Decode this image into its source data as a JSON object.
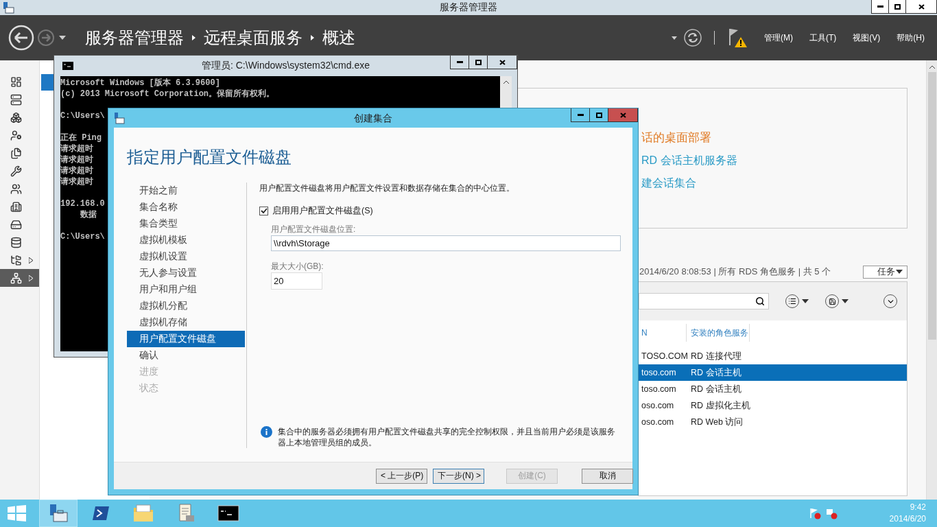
{
  "main_window": {
    "title": "服务器管理器",
    "breadcrumb": [
      "服务器管理器",
      "远程桌面服务",
      "概述"
    ],
    "menus": [
      "管理(M)",
      "工具(T)",
      "视图(V)",
      "帮助(H)"
    ],
    "sidebar": [
      {
        "selected": false,
        "expandable": false
      },
      {
        "selected": false,
        "expandable": false
      },
      {
        "selected": false,
        "expandable": false
      },
      {
        "selected": false,
        "expandable": false
      },
      {
        "selected": false,
        "expandable": false
      },
      {
        "selected": false,
        "expandable": false
      },
      {
        "selected": false,
        "expandable": false
      },
      {
        "selected": false,
        "expandable": false
      },
      {
        "selected": false,
        "expandable": false
      },
      {
        "selected": false,
        "expandable": false
      },
      {
        "selected": false,
        "expandable": true
      },
      {
        "selected": true,
        "expandable": true
      }
    ],
    "overview_links": [
      {
        "text": "话的桌面部署",
        "kind": "primary"
      },
      {
        "text": "RD 会话主机服务器",
        "kind": "secondary"
      },
      {
        "text": "建会话集合",
        "kind": "secondary"
      }
    ],
    "servers": {
      "summary": "2014/6/20 8:08:53 | 所有 RDS 角色服务 | 共 5 个",
      "tasks_button": "任务",
      "columns": [
        "N",
        "安装的角色服务"
      ],
      "rows": [
        {
          "cells": [
            "TOSO.COM",
            "RD 连接代理"
          ],
          "selected": false
        },
        {
          "cells": [
            "toso.com",
            "RD 会话主机"
          ],
          "selected": true
        },
        {
          "cells": [
            "toso.com",
            "RD 会话主机"
          ],
          "selected": false
        },
        {
          "cells": [
            "oso.com",
            "RD 虚拟化主机"
          ],
          "selected": false
        },
        {
          "cells": [
            "oso.com",
            "RD Web 访问"
          ],
          "selected": false
        }
      ]
    }
  },
  "cmd_window": {
    "title": "管理员: C:\\Windows\\system32\\cmd.exe",
    "output": [
      [
        "Microsoft Windows [版本 6.3.9600]",
        "(c) 2013 Microsoft Corporation。保留所有权利。"
      ],
      [
        "C:\\Users\\"
      ],
      [
        "正在 Ping",
        "请求超时",
        "请求超时",
        "请求超时",
        "请求超时"
      ],
      [
        "192.168.0",
        "    数据"
      ],
      [
        "C:\\Users\\"
      ]
    ]
  },
  "dialog": {
    "title": "创建集合",
    "heading": "指定用户配置文件磁盘",
    "steps": [
      {
        "label": "开始之前",
        "selected": false,
        "disabled": false
      },
      {
        "label": "集合名称",
        "selected": false,
        "disabled": false
      },
      {
        "label": "集合类型",
        "selected": false,
        "disabled": false
      },
      {
        "label": "虚拟机模板",
        "selected": false,
        "disabled": false
      },
      {
        "label": "虚拟机设置",
        "selected": false,
        "disabled": false
      },
      {
        "label": "无人参与设置",
        "selected": false,
        "disabled": false
      },
      {
        "label": "用户和用户组",
        "selected": false,
        "disabled": false
      },
      {
        "label": "虚拟机分配",
        "selected": false,
        "disabled": false
      },
      {
        "label": "虚拟机存储",
        "selected": false,
        "disabled": false
      },
      {
        "label": "用户配置文件磁盘",
        "selected": true,
        "disabled": false
      },
      {
        "label": "确认",
        "selected": false,
        "disabled": false
      },
      {
        "label": "进度",
        "selected": false,
        "disabled": true
      },
      {
        "label": "状态",
        "selected": false,
        "disabled": true
      }
    ],
    "description": "用户配置文件磁盘将用户配置文件设置和数据存储在集合的中心位置。",
    "enable_checkbox": {
      "label": "启用用户配置文件磁盘(S)",
      "checked": true
    },
    "location": {
      "label": "用户配置文件磁盘位置:",
      "value": "\\\\rdvh\\Storage"
    },
    "max_size": {
      "label": "最大大小(GB):",
      "value": "20"
    },
    "note": "集合中的服务器必须拥有用户配置文件磁盘共享的完全控制权限，并且当前用户必须是该服务器上本地管理员组的成员。",
    "buttons": [
      {
        "label": "< 上一步(P)",
        "disabled": false,
        "focused": false
      },
      {
        "label": "下一步(N) >",
        "disabled": false,
        "focused": true
      },
      {
        "label": "创建(C)",
        "disabled": true,
        "focused": false
      },
      {
        "label": "取消",
        "disabled": false,
        "focused": false
      }
    ]
  },
  "taskbar": {
    "apps": [
      {
        "kind": "server-manager",
        "active": true
      },
      {
        "kind": "powershell",
        "active": false
      },
      {
        "kind": "explorer",
        "active": false
      },
      {
        "kind": "document",
        "active": false
      },
      {
        "kind": "cmd",
        "active": false
      }
    ],
    "time": "9:42",
    "date": "2014/6/20"
  }
}
